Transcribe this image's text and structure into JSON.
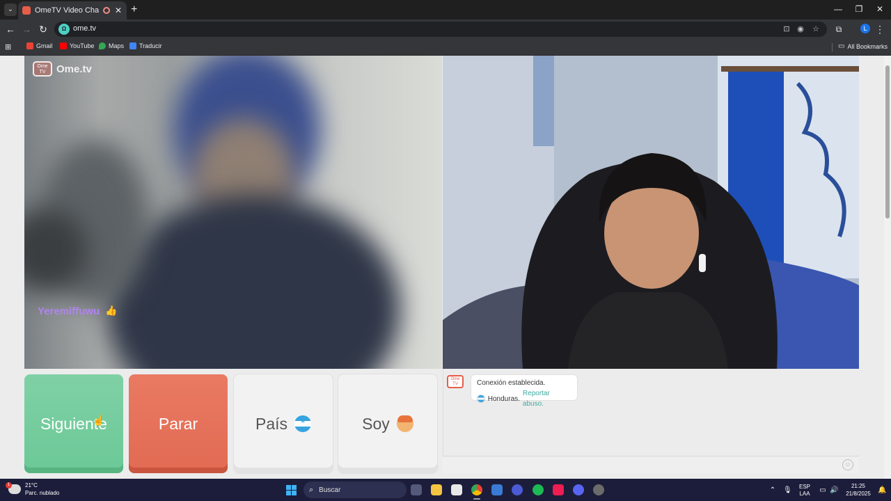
{
  "browser": {
    "tab_title": "OmeTV Video Chat — Ome",
    "url": "ome.tv",
    "profile_initial": "L",
    "bookmarks": [
      {
        "label": "Gmail",
        "color": "#ea4335"
      },
      {
        "label": "YouTube",
        "color": "#ff0000"
      },
      {
        "label": "Maps",
        "color": "#34a853"
      },
      {
        "label": "Traducir",
        "color": "#4285f4"
      }
    ],
    "all_bookmarks": "All Bookmarks"
  },
  "app": {
    "logo_text": "Ome.tv",
    "logo_badge": "Ome TV",
    "partner_name": "Yeremiffuwu",
    "buttons": {
      "next": "Siguiente",
      "stop": "Parar",
      "country": "País",
      "iam": "Soy"
    },
    "chat": {
      "logo_badge": "Ome TV",
      "connection": "Conexión establecida.",
      "country": "Honduras.",
      "report": "Reportar abuso."
    }
  },
  "taskbar": {
    "temperature": "21°C",
    "weather": "Parc. nublado",
    "search": "Buscar",
    "lang_top": "ESP",
    "lang_bottom": "LAA",
    "time": "21:25",
    "date": "21/8/2025"
  },
  "colors": {
    "next_button": "#6cc897",
    "stop_button": "#e16a52",
    "username": "#b084f0",
    "report_link": "#3fa9a0"
  }
}
